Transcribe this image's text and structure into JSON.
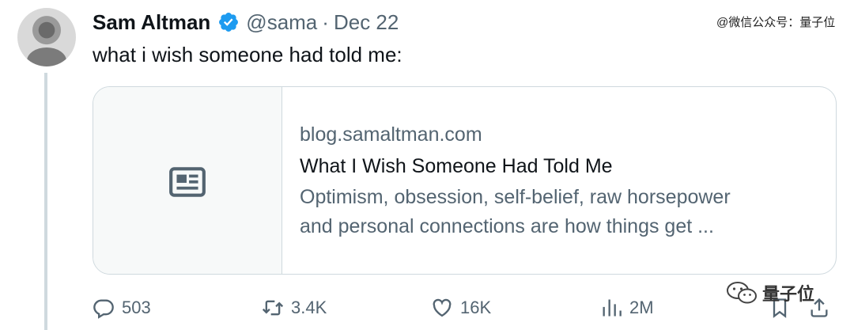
{
  "tweet": {
    "author_name": "Sam Altman",
    "handle": "@sama",
    "separator": "·",
    "date": "Dec 22",
    "text": "what i wish someone had told me:"
  },
  "card": {
    "domain": "blog.samaltman.com",
    "title": "What I Wish Someone Had Told Me",
    "description_line1": "Optimism, obsession, self-belief, raw horsepower",
    "description_line2": "and personal connections are how things get ..."
  },
  "actions": {
    "replies": "503",
    "retweets": "3.4K",
    "likes": "16K",
    "views": "2M"
  },
  "watermarks": {
    "top": "@微信公众号：量子位",
    "bottom": "量子位"
  },
  "colors": {
    "verified": "#1d9bf0",
    "text_primary": "#0f1419",
    "text_secondary": "#536471",
    "border": "#cfd9de",
    "card_thumb_bg": "#f7f9f9"
  },
  "icons": [
    "verified-badge-icon",
    "article-icon",
    "reply-icon",
    "retweet-icon",
    "like-icon",
    "views-icon",
    "bookmark-icon",
    "share-icon",
    "wechat-icon"
  ]
}
